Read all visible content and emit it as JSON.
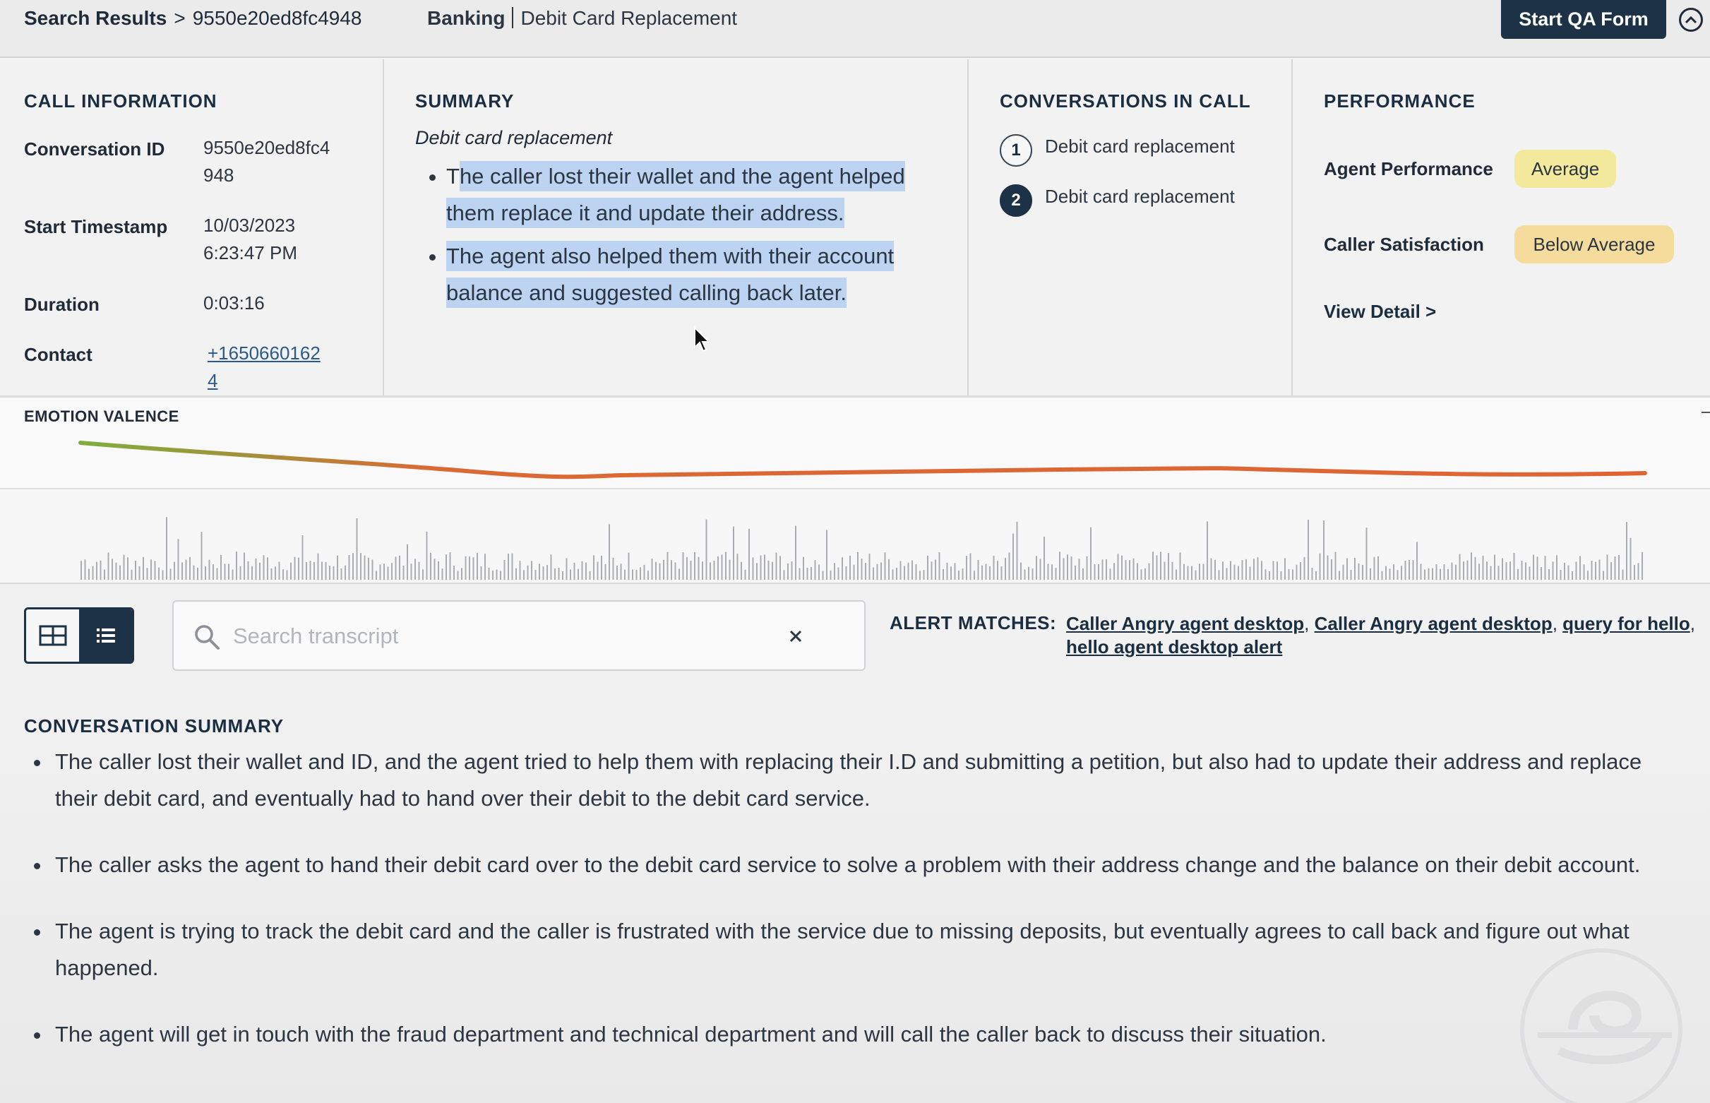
{
  "header": {
    "breadcrumb_root": "Search Results",
    "breadcrumb_sep": ">",
    "breadcrumb_current": "9550e20ed8fc4948",
    "category": "Banking",
    "subcategory": "Debit Card Replacement",
    "qa_button": "Start QA Form",
    "collapse_icon": "chevron-up-circle-icon"
  },
  "call_info": {
    "title": "CALL INFORMATION",
    "conversation_id_label": "Conversation ID",
    "conversation_id_line1": "9550e20ed8fc4",
    "conversation_id_line2": "948",
    "start_label": "Start Timestamp",
    "start_date": "10/03/2023",
    "start_time": "6:23:47 PM",
    "duration_label": "Duration",
    "duration": "0:03:16",
    "contact_label": "Contact",
    "contact_line1": "+1650660162",
    "contact_line2": "4"
  },
  "summary": {
    "title": "SUMMARY",
    "subtitle": "Debit card replacement",
    "bullets": [
      {
        "first": "T",
        "rest": "he caller lost their wallet and the agent helped them replace it and update their address."
      },
      {
        "first": "",
        "rest": "The agent also helped them with their account balance and suggested calling back later."
      }
    ]
  },
  "conversations": {
    "title": "CONVERSATIONS IN CALL",
    "items": [
      {
        "num": "1",
        "label": "Debit card replacement",
        "active": false
      },
      {
        "num": "2",
        "label": "Debit card replacement",
        "active": true
      }
    ]
  },
  "performance": {
    "title": "PERFORMANCE",
    "agent_label": "Agent Performance",
    "agent_value": "Average",
    "caller_label": "Caller Satisfaction",
    "caller_value": "Below Average",
    "view_detail": "View Detail >",
    "colors": {
      "average": "#f3e99c",
      "below_average": "#f5dc9c"
    }
  },
  "emotion": {
    "title": "EMOTION VALENCE",
    "colors": {
      "positive": "#7fae3c",
      "negative": "#df6434"
    }
  },
  "toolbar": {
    "grid_icon": "grid-view-icon",
    "list_icon": "list-view-icon",
    "search_placeholder": "Search transcript",
    "search_value": "",
    "search_icon": "search-icon",
    "clear_icon": "close-icon",
    "alerts_label": "ALERT MATCHES:",
    "alerts": [
      "Caller Angry agent desktop",
      "Caller Angry agent desktop",
      "query for hello",
      "hello agent desktop alert"
    ]
  },
  "conversation_summary": {
    "title": "CONVERSATION SUMMARY",
    "bullets": [
      "The caller lost their wallet and ID, and the agent tried to help them with replacing their I.D and submitting a petition, but also had to update their address and replace their debit card, and eventually had to hand over their debit to the debit card service.",
      "The caller asks the agent to hand their debit card over to the debit card service to solve a problem with their address change and the balance on their debit account.",
      "The agent is trying to track the debit card and the caller is frustrated with the service due to missing deposits, but eventually agrees to call back and figure out what happened.",
      "The agent will get in touch with the fraud department and technical department and will call the caller back to discuss their situation."
    ]
  },
  "accent_color": "#1d3246"
}
